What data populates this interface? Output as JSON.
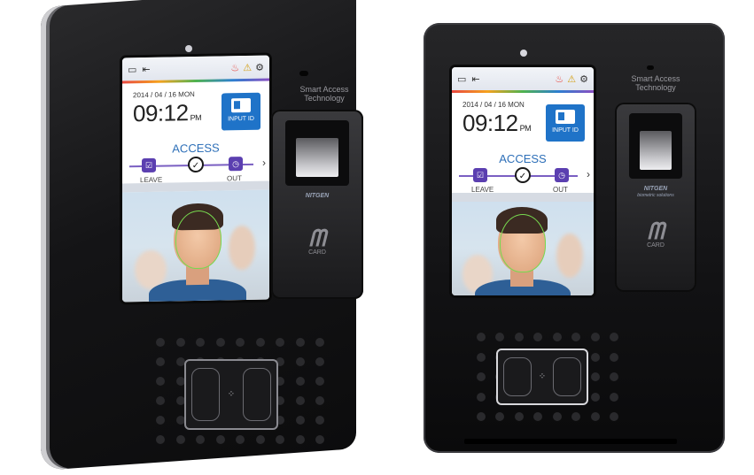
{
  "screen": {
    "date": "2014 / 04 / 16 MON",
    "time": "09:12",
    "ampm": "PM",
    "input_id_label": "INPUT ID",
    "access_label": "ACCESS",
    "leave_label": "LEAVE",
    "out_label": "OUT"
  },
  "device": {
    "brand_line1": "Smart Access",
    "brand_line2": "Technology",
    "sensor_brand": "NITGEN",
    "sensor_sub": "biometric solutions",
    "card_label": "CARD"
  },
  "colors": {
    "device_body": "#141416",
    "screen_accent": "#2d6fb8",
    "input_id_bg": "#1f73c8",
    "mode_purple": "#5b3fb0",
    "face_contour": "#77d94f"
  },
  "icons": [
    "monitor-icon",
    "logout-icon",
    "fire-icon",
    "warning-icon",
    "gear-icon",
    "checkmark-icon",
    "chevron-right-icon",
    "keypad-icon"
  ]
}
